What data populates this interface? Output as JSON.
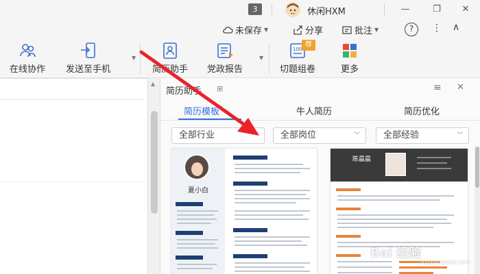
{
  "titlebar": {
    "tab_count": "3",
    "user_name": "休闲HXM",
    "icons": [
      "avatar-icon",
      "minimize-icon",
      "restore-icon",
      "close-icon"
    ]
  },
  "commands": {
    "unsaved": "未保存",
    "share": "分享",
    "annotate": "批注",
    "help": "?",
    "more": "⋮",
    "collapse": "∧"
  },
  "ribbon": {
    "items": [
      {
        "label": "在线协作",
        "icon": "collaboration-icon"
      },
      {
        "label": "发送至手机",
        "icon": "send-to-phone-icon"
      },
      {
        "label": "简历助手",
        "icon": "resume-helper-icon"
      },
      {
        "label": "党政报告",
        "icon": "report-icon"
      },
      {
        "label": "切题组卷",
        "icon": "exam-icon"
      },
      {
        "label": "更多",
        "icon": "more-apps-icon"
      }
    ],
    "exam_badge": "荐"
  },
  "panel": {
    "title": "简历助手",
    "tabs": [
      {
        "label": "简历模板",
        "active": true
      },
      {
        "label": "牛人简历",
        "active": false
      },
      {
        "label": "简历优化",
        "active": false
      }
    ],
    "filters": [
      {
        "label": "全部行业"
      },
      {
        "label": "全部岗位"
      },
      {
        "label": "全部经验"
      }
    ],
    "resume1": {
      "name": "夏小白"
    },
    "resume2": {
      "name": "陈晨晨"
    }
  },
  "watermark": {
    "text": "Bai 经验",
    "sub": "jingyan.baidu.com"
  },
  "colors": {
    "accent": "#2f6fd6",
    "arrow": "#e8232a",
    "resume_navy": "#1f3f73",
    "resume_orange": "#e8823a"
  }
}
